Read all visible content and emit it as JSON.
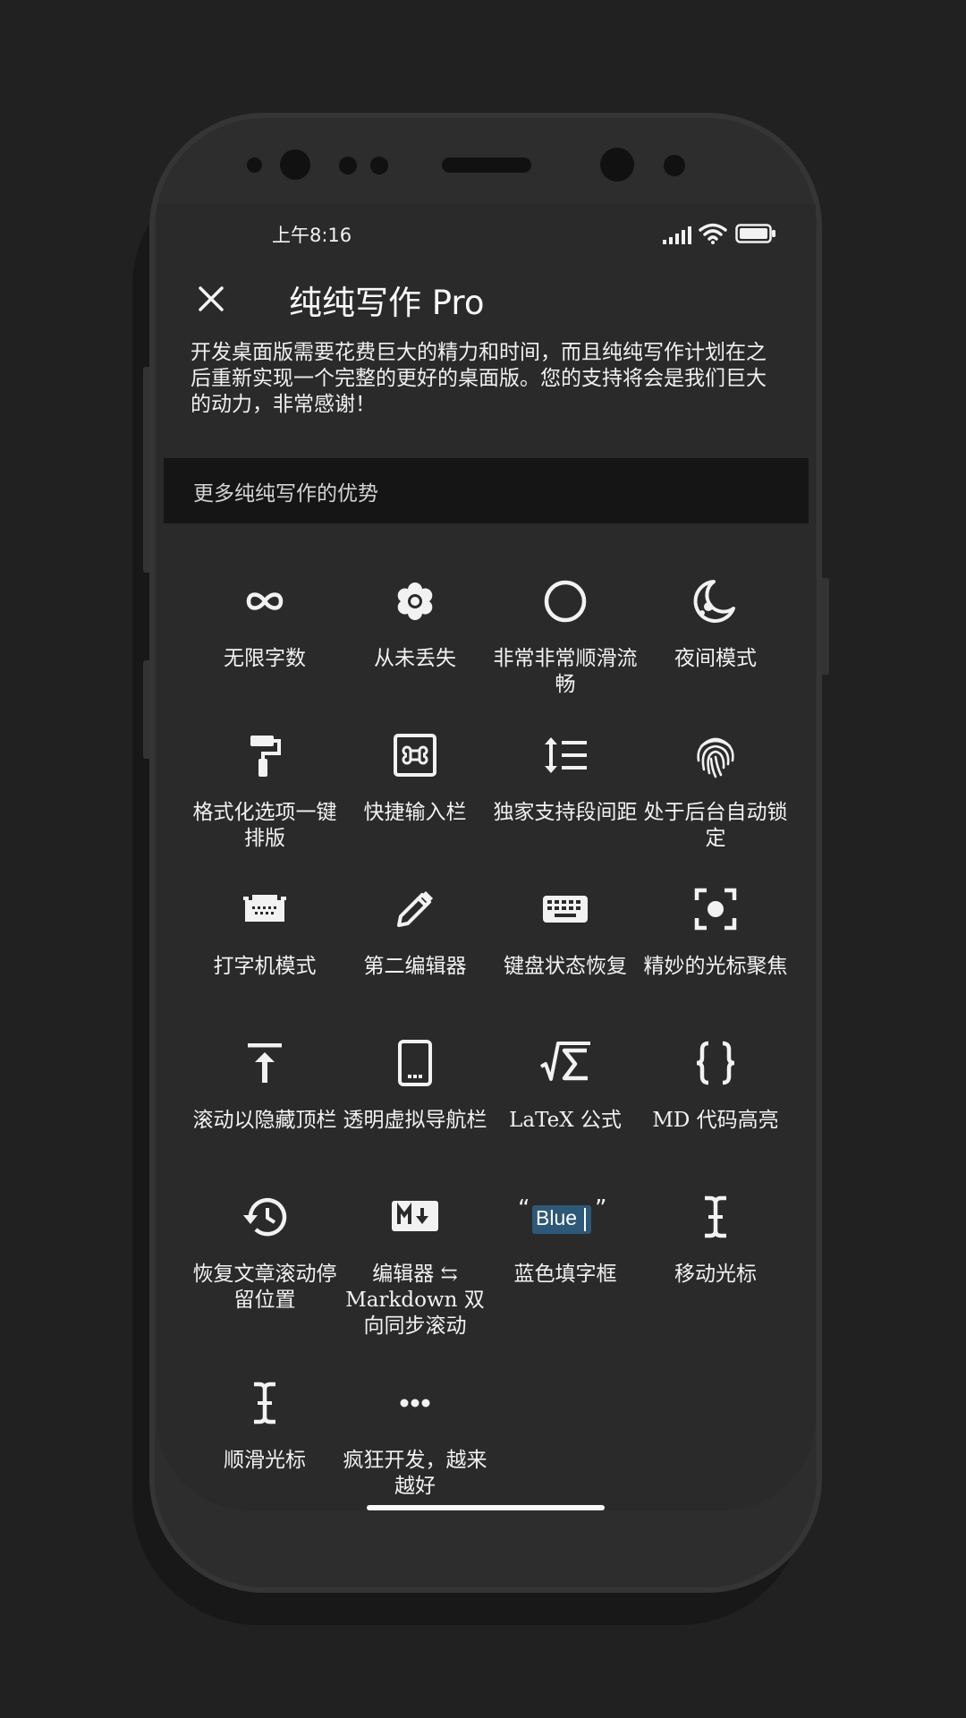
{
  "status_bar": {
    "time": "上午8:16",
    "icons": [
      "signal-icon",
      "wifi-icon",
      "battery-icon"
    ]
  },
  "header": {
    "title": "纯纯写作 Pro",
    "close_icon": "close-icon"
  },
  "description": "开发桌面版需要花费巨大的精力和时间，而且纯纯写作计划在之后重新实现一个完整的更好的桌面版。您的支持将会是我们巨大的动力，非常感谢！",
  "section_title": "更多纯纯写作的优势",
  "features": [
    {
      "label": "无限字数",
      "icon": "infinity-icon"
    },
    {
      "label": "从未丢失",
      "icon": "flower-icon"
    },
    {
      "label": "非常非常顺滑流畅",
      "icon": "circle-icon"
    },
    {
      "label": "夜间模式",
      "icon": "moon-icon"
    },
    {
      "label": "格式化选项一键排版",
      "icon": "paint-roller-icon"
    },
    {
      "label": "快捷输入栏",
      "icon": "command-key-icon"
    },
    {
      "label": "独家支持段间距",
      "icon": "line-spacing-icon"
    },
    {
      "label": "处于后台自动锁定",
      "icon": "fingerprint-icon"
    },
    {
      "label": "打字机模式",
      "icon": "typewriter-icon"
    },
    {
      "label": "第二编辑器",
      "icon": "pencil-icon"
    },
    {
      "label": "键盘状态恢复",
      "icon": "keyboard-icon"
    },
    {
      "label": "精妙的光标聚焦",
      "icon": "focus-center-icon"
    },
    {
      "label": "滚动以隐藏顶栏",
      "icon": "scroll-top-icon"
    },
    {
      "label": "透明虚拟导航栏",
      "icon": "tablet-icon"
    },
    {
      "label": "LaTeX 公式",
      "icon": "formula-icon"
    },
    {
      "label": "MD 代码高亮",
      "icon": "code-braces-icon"
    },
    {
      "label": "恢复文章滚动停留位置",
      "icon": "history-icon"
    },
    {
      "label": "编辑器 ⇆ Markdown 双向同步滚动",
      "icon": "markdown-icon"
    },
    {
      "label": "蓝色填字框",
      "icon": "blue-fill-box-icon",
      "box_text": "Blue",
      "quote_open": "“",
      "quote_close": "”",
      "box_color": "#2e5878"
    },
    {
      "label": "移动光标",
      "icon": "text-cursor-icon"
    },
    {
      "label": "顺滑光标",
      "icon": "text-cursor-icon"
    },
    {
      "label": "疯狂开发，越来越好",
      "icon": "more-dots-icon"
    }
  ],
  "colors": {
    "background": "#212121",
    "screen": "#2a2a2a",
    "section_bar": "#151515",
    "text": "#f2f2f2"
  }
}
